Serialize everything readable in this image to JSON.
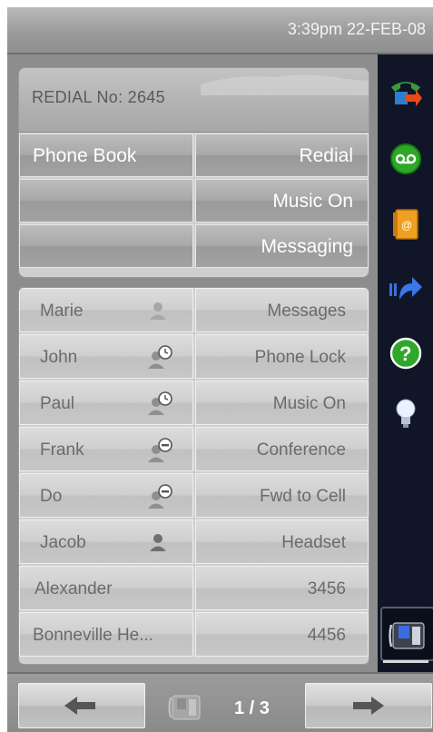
{
  "status": {
    "datetime": "3:39pm 22-FEB-08"
  },
  "redial": {
    "label": "REDIAL No:  2645"
  },
  "softkeys": [
    {
      "left": "Phone Book",
      "right": "Redial"
    },
    {
      "left": "",
      "right": "Music On"
    },
    {
      "left": "",
      "right": "Messaging"
    }
  ],
  "contacts": [
    {
      "name": "Marie",
      "presence": "available-light",
      "action": "Messages"
    },
    {
      "name": "John",
      "presence": "away-clock",
      "action": "Phone Lock"
    },
    {
      "name": "Paul",
      "presence": "away-clock",
      "action": "Music On"
    },
    {
      "name": "Frank",
      "presence": "busy",
      "action": "Conference"
    },
    {
      "name": "Do",
      "presence": "busy",
      "action": "Fwd to Cell"
    },
    {
      "name": "Jacob",
      "presence": "available",
      "action": "Headset"
    },
    {
      "name": "Alexander",
      "presence": "",
      "action": "3456"
    },
    {
      "name": "Bonneville He...",
      "presence": "",
      "action": "4456"
    }
  ],
  "sidebar": {
    "icons": [
      "call-forward-icon",
      "voicemail-icon",
      "address-book-icon",
      "transfer-icon",
      "help-icon",
      "lightbulb-icon",
      "desk-phone-icon"
    ]
  },
  "pagination": {
    "label": "1 / 3"
  },
  "colors": {
    "accent_green": "#2fa82a",
    "sidebar_bg": "#101628",
    "panel_grey": "#8d8d8d"
  }
}
